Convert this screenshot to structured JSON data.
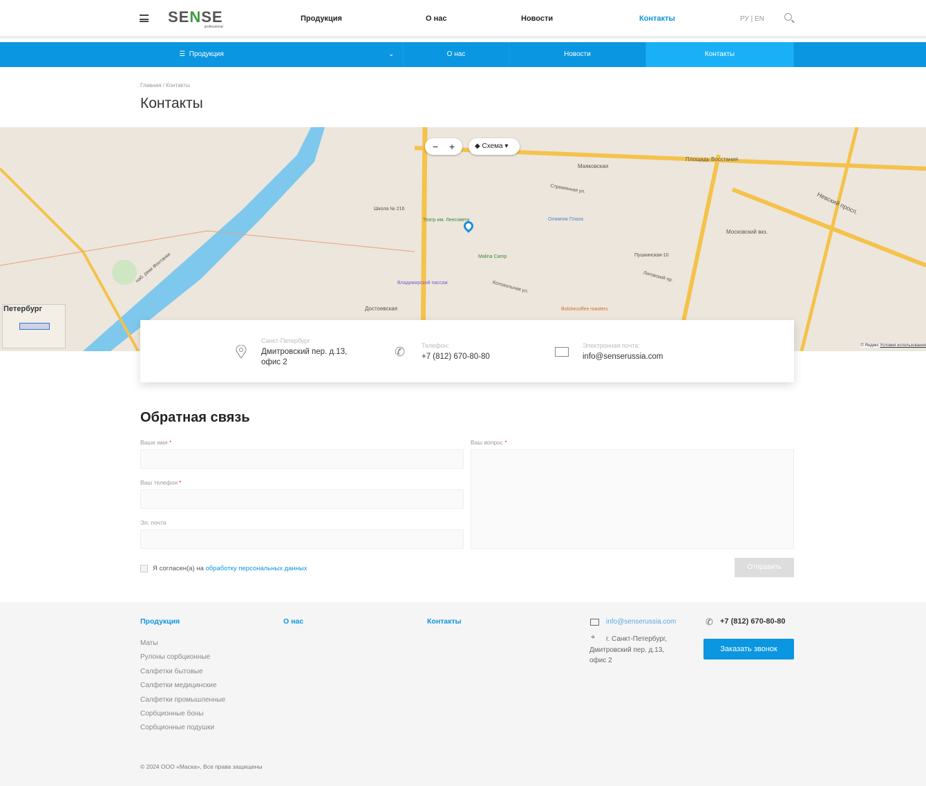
{
  "header": {
    "logo": "SENSE",
    "logo_sub": "professional",
    "nav": [
      "Продукция",
      "О нас",
      "Новости",
      "Контакты"
    ],
    "lang": "РУ | EN"
  },
  "bluenav": {
    "items": [
      "Продукция",
      "О нас",
      "Новости",
      "Контакты"
    ]
  },
  "breadcrumb": {
    "home": "Главная",
    "sep": "/",
    "current": "Контакты"
  },
  "page_title": "Контакты",
  "map": {
    "scheme_label": "Схема",
    "zoom_out": "−",
    "zoom_in": "+",
    "minimap_label": "Петербург",
    "copyright": "© Яндекс",
    "terms": "Условия использования",
    "labels": [
      "Маяковская",
      "Площадь Восстания",
      "Достоевская",
      "Владимирский пассаж",
      "Невский просп.",
      "наб. реки Фонтанки",
      "Московский вкз.",
      "Пушкинская-10",
      "Malina Camp",
      "Школа № 216",
      "Театр им. Ленсовета",
      "Стремянная ул.",
      "Лиговский пр.",
      "Bolshecoffee roasters",
      "Колокольная ул.",
      "Олимпик Плаза"
    ]
  },
  "contacts": {
    "city": "Санкт-Петербург",
    "address": "Дмитровский пер. д.13,",
    "office": "офис 2",
    "phone_label": "Телефон:",
    "phone": "+7 (812) 670-80-80",
    "email_label": "Электронная почта:",
    "email": "info@senserussia.com"
  },
  "form": {
    "title": "Обратная связь",
    "name_label": "Ваше имя",
    "phone_label": "Ваш телефон",
    "email_label": "Эл. почта",
    "question_label": "Ваш вопрос",
    "required": "*",
    "consent_text": "Я согласен(а) на",
    "consent_link": "обработку персональных данных",
    "submit": "Отправить"
  },
  "footer": {
    "col1_title": "Продукция",
    "col1_items": [
      "Маты",
      "Рулоны сорбционные",
      "Салфетки бытовые",
      "Салфетки медицинские",
      "Салфетки промышленные",
      "Сорбционные боны",
      "Сорбционные подушки"
    ],
    "col2_title": "О нас",
    "col3_title": "Контакты",
    "email": "info@senserussia.com",
    "address1": "г. Санкт-Петербург,",
    "address2": "Дмитровский пер. д.13,",
    "address3": "офис 2",
    "phone": "+7 (812) 670-80-80",
    "callback": "Заказать звонок",
    "copyright": "© 2024 ООО «Маска», Все права защищены"
  },
  "colors": {
    "accent": "#0a96e0",
    "active": "#1ab0f7"
  }
}
